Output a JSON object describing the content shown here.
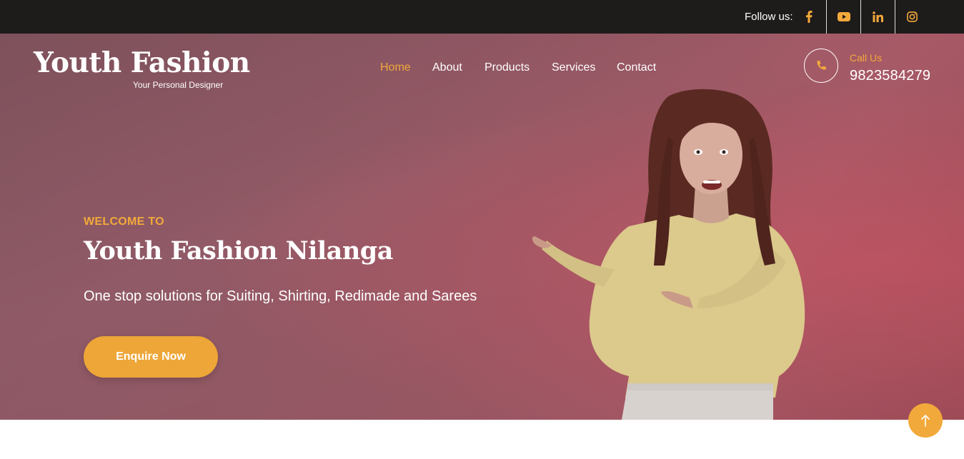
{
  "topbar": {
    "follow_label": "Follow us:",
    "social_icons": [
      "facebook-icon",
      "youtube-icon",
      "linkedin-icon",
      "instagram-icon"
    ],
    "accent_color": "#f2a93b"
  },
  "brand": {
    "title": "Youth Fashion",
    "tagline": "Your Personal Designer"
  },
  "nav": {
    "items": [
      {
        "label": "Home",
        "active": true
      },
      {
        "label": "About",
        "active": false
      },
      {
        "label": "Products",
        "active": false
      },
      {
        "label": "Services",
        "active": false
      },
      {
        "label": "Contact",
        "active": false
      }
    ]
  },
  "call": {
    "label": "Call Us",
    "number": "9823584279",
    "icon": "phone-icon"
  },
  "hero": {
    "welcome": "WELCOME TO",
    "title": "Youth Fashion Nilanga",
    "subtitle": "One stop solutions for Suiting, Shirting, Redimade and Sarees",
    "cta_label": "Enquire Now",
    "background_color": "#9a5965",
    "cta_color": "#eda637"
  },
  "back_to_top": {
    "icon": "arrow-up-icon"
  }
}
